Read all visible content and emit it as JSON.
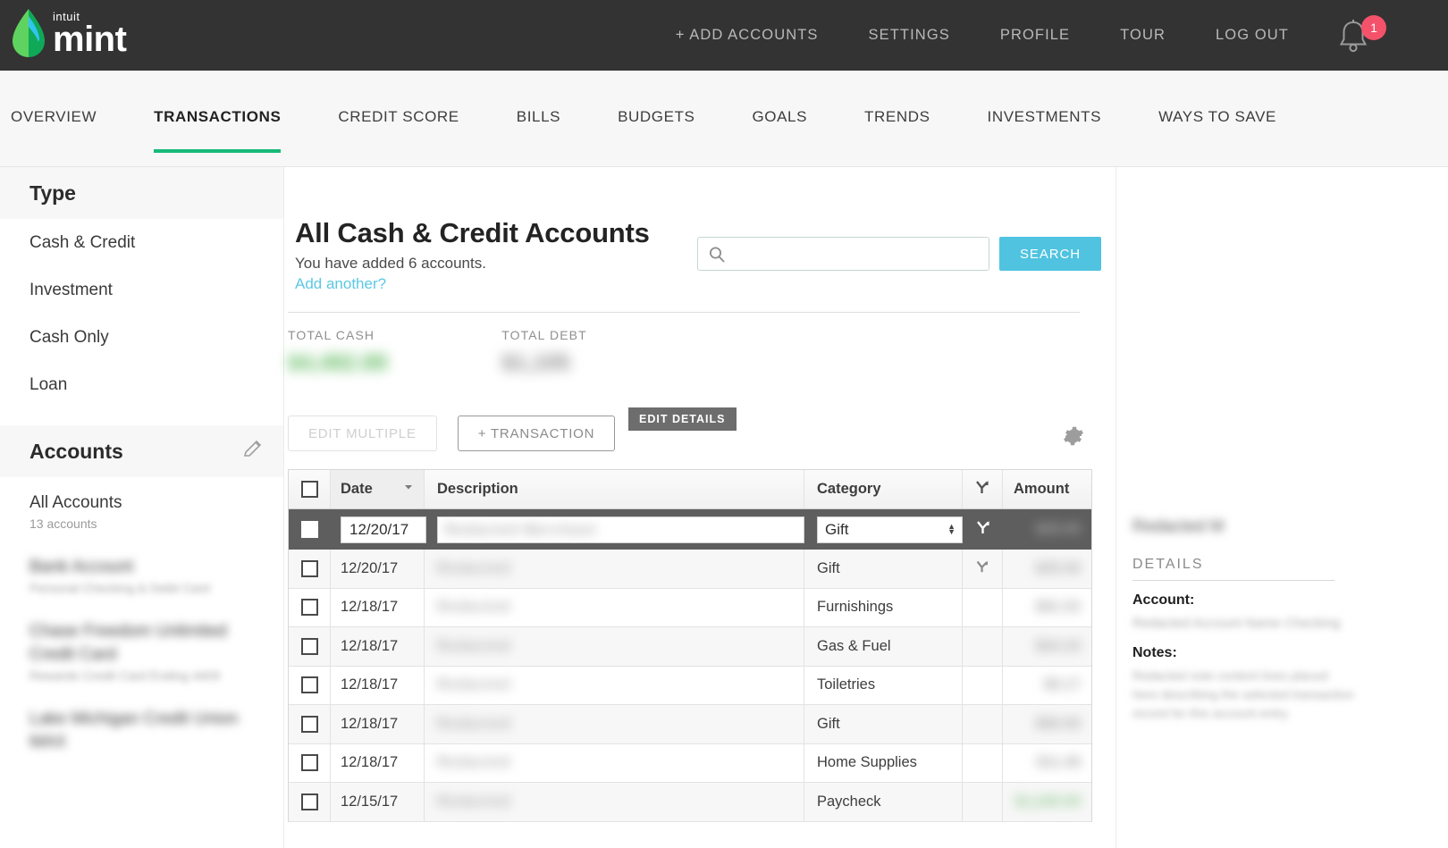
{
  "brand": {
    "intuit": "intuit",
    "name": "mint",
    "leaf_colors": [
      "#5fd35f",
      "#0fa958",
      "#31c5f0"
    ]
  },
  "topnav": {
    "items": [
      {
        "label": "+ ADD ACCOUNTS"
      },
      {
        "label": "SETTINGS"
      },
      {
        "label": "PROFILE"
      },
      {
        "label": "TOUR"
      },
      {
        "label": "LOG OUT"
      }
    ],
    "notification_count": "1",
    "notification_color": "#f4526a"
  },
  "subnav": {
    "active_color": "#18ba76",
    "items": [
      {
        "label": "OVERVIEW",
        "active": false
      },
      {
        "label": "TRANSACTIONS",
        "active": true
      },
      {
        "label": "CREDIT SCORE",
        "active": false
      },
      {
        "label": "BILLS",
        "active": false
      },
      {
        "label": "BUDGETS",
        "active": false
      },
      {
        "label": "GOALS",
        "active": false
      },
      {
        "label": "TRENDS",
        "active": false
      },
      {
        "label": "INVESTMENTS",
        "active": false
      },
      {
        "label": "WAYS TO SAVE",
        "active": false
      }
    ]
  },
  "sidebar": {
    "type_header": "Type",
    "type_items": [
      {
        "label": "Cash & Credit"
      },
      {
        "label": "Investment"
      },
      {
        "label": "Cash Only"
      },
      {
        "label": "Loan"
      }
    ],
    "accounts_header": "Accounts",
    "edit_icon": "pencil-icon",
    "accounts": [
      {
        "name": "All Accounts",
        "sub": "13 accounts",
        "redacted": false
      },
      {
        "name": "Bank Account",
        "sub": "Personal Checking & Debit Card",
        "redacted": true
      },
      {
        "name": "Chase Freedom Unlimited Credit Card",
        "sub": "Rewards Credit Card Ending 4409",
        "redacted": true
      },
      {
        "name": "Lake Michigan Credit Union MAX",
        "sub": "",
        "redacted": true
      }
    ]
  },
  "main": {
    "title": "All Cash & Credit Accounts",
    "subtitle": "You have added 6 accounts.",
    "add_another": "Add another?",
    "search": {
      "value": "",
      "placeholder": "",
      "icon": "search-icon"
    },
    "search_button": "SEARCH",
    "totals": [
      {
        "label": "TOTAL CASH",
        "value": "$4,482.88",
        "redacted": true,
        "color": "#5cb85c"
      },
      {
        "label": "TOTAL DEBT",
        "value": "$1,105",
        "redacted": true,
        "color": "#8a8a8a"
      }
    ],
    "buttons": {
      "edit_multiple": "EDIT MULTIPLE",
      "add_transaction": "+ TRANSACTION",
      "settings_icon": "gear-icon"
    },
    "edit_details_tooltip": "EDIT DETAILS"
  },
  "table": {
    "columns": [
      {
        "label": "",
        "name": "select-all"
      },
      {
        "label": "Date",
        "name": "date",
        "sort": "desc",
        "sort_icon": "chevron-down-icon"
      },
      {
        "label": "Description",
        "name": "description"
      },
      {
        "label": "Category",
        "name": "category"
      },
      {
        "label": "",
        "name": "split",
        "icon": "split-icon"
      },
      {
        "label": "Amount",
        "name": "amount"
      }
    ],
    "editing_row": {
      "date": "12/20/17",
      "description": "Redacted Merchant",
      "category": "Gift",
      "amount": "$25.00",
      "split_icon": "split-icon"
    },
    "rows": [
      {
        "date": "12/20/17",
        "description": "Redacted",
        "category": "Gift",
        "amount": "$25.00",
        "split": true,
        "amount_positive": false
      },
      {
        "date": "12/18/17",
        "description": "Redacted",
        "category": "Furnishings",
        "amount": "$81.53",
        "split": false,
        "amount_positive": false
      },
      {
        "date": "12/18/17",
        "description": "Redacted",
        "category": "Gas & Fuel",
        "amount": "$24.10",
        "split": false,
        "amount_positive": false
      },
      {
        "date": "12/18/17",
        "description": "Redacted",
        "category": "Toiletries",
        "amount": "$8.17",
        "split": false,
        "amount_positive": false
      },
      {
        "date": "12/18/17",
        "description": "Redacted",
        "category": "Gift",
        "amount": "$65.00",
        "split": false,
        "amount_positive": false
      },
      {
        "date": "12/18/17",
        "description": "Redacted",
        "category": "Home Supplies",
        "amount": "$11.48",
        "split": false,
        "amount_positive": false
      },
      {
        "date": "12/15/17",
        "description": "Redacted",
        "category": "Paycheck",
        "amount": "$1,240.00",
        "split": false,
        "amount_positive": true
      }
    ]
  },
  "details_panel": {
    "merchant": "Redacted M",
    "section_header": "DETAILS",
    "account_label": "Account:",
    "account_value": "Redacted Account Name Checking",
    "notes_label": "Notes:",
    "notes_value": "Redacted note content lines placed here describing the selected transaction record for this account entry."
  }
}
